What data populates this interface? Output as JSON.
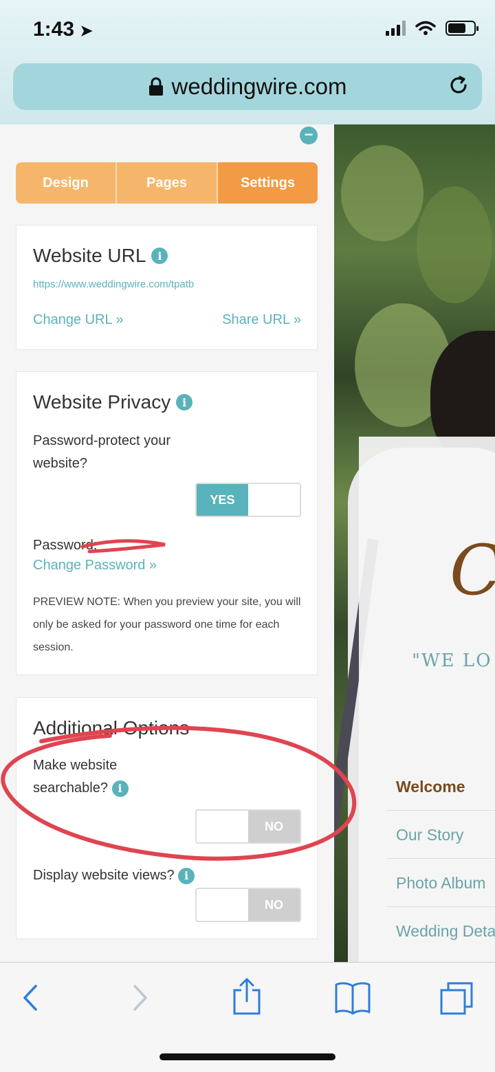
{
  "status": {
    "time": "1:43"
  },
  "browser": {
    "url": "weddingwire.com"
  },
  "tabs": [
    "Design",
    "Pages",
    "Settings"
  ],
  "website_url": {
    "title": "Website URL",
    "url": "https://www.weddingwire.com/tpatb",
    "change_label": "Change URL »",
    "share_label": "Share URL »"
  },
  "privacy": {
    "title": "Website Privacy",
    "question": "Password-protect your website?",
    "toggle_value": "YES",
    "password_label": "Password:",
    "change_password": "Change Password »",
    "note": "PREVIEW NOTE: When you preview your site, you will only be asked for your password one time for each session."
  },
  "additional": {
    "title": "Additional Options",
    "searchable_question": "Make website searchable?",
    "searchable_value": "NO",
    "views_question": "Display website views?",
    "views_value": "NO"
  },
  "preview": {
    "script_letter": "C",
    "quote": "\"WE LO",
    "nav": [
      "Welcome",
      "Our Story",
      "Photo Album",
      "Wedding Deta"
    ]
  },
  "colors": {
    "accent": "#5ab2bb",
    "tab_orange": "#f5b66c",
    "tab_active": "#f39a45",
    "scribble": "#e04450"
  }
}
